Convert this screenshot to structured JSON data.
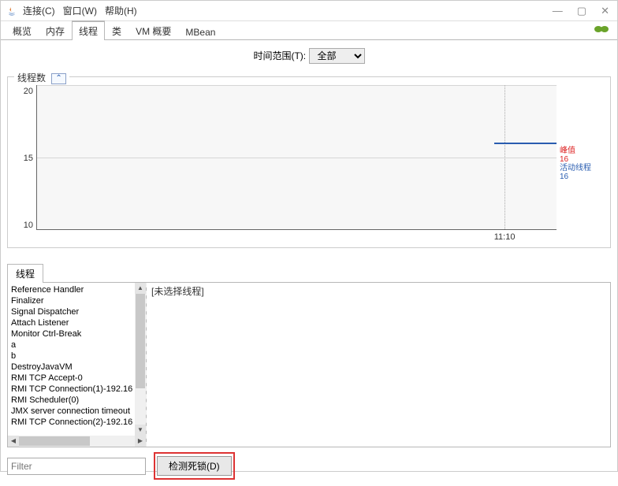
{
  "titlebar": {
    "menus": [
      "连接(C)",
      "窗口(W)",
      "帮助(H)"
    ],
    "win_min": "—",
    "win_max": "▢",
    "win_close": "✕"
  },
  "tabs": [
    "概览",
    "内存",
    "线程",
    "类",
    "VM 概要",
    "MBean"
  ],
  "active_tab_index": 2,
  "timerange": {
    "label": "时间范围(T):",
    "selected": "全部"
  },
  "chart": {
    "title": "线程数",
    "collapse": "⌃",
    "yticks": [
      "20",
      "15",
      "10"
    ],
    "xticks": [
      "11:10"
    ],
    "legend": {
      "peak_label": "峰值",
      "peak_value": "16",
      "live_label": "活动线程",
      "live_value": "16"
    }
  },
  "chart_data": {
    "type": "line",
    "title": "线程数",
    "xlabel": "",
    "ylabel": "",
    "ylim": [
      10,
      20
    ],
    "x": [
      "11:10"
    ],
    "series": [
      {
        "name": "活动线程",
        "values": [
          16
        ]
      },
      {
        "name": "峰值",
        "values": [
          16
        ]
      }
    ]
  },
  "threads": {
    "tab_label": "线程",
    "list": [
      "Reference Handler",
      "Finalizer",
      "Signal Dispatcher",
      "Attach Listener",
      "Monitor Ctrl-Break",
      "a",
      "b",
      "DestroyJavaVM",
      "RMI TCP Accept-0",
      "RMI TCP Connection(1)-192.16",
      "RMI Scheduler(0)",
      "JMX server connection timeout",
      "RMI TCP Connection(2)-192.16"
    ],
    "detail_placeholder": "[未选择线程]"
  },
  "footer": {
    "filter_placeholder": "Filter",
    "detect_button": "检测死锁(D)"
  }
}
